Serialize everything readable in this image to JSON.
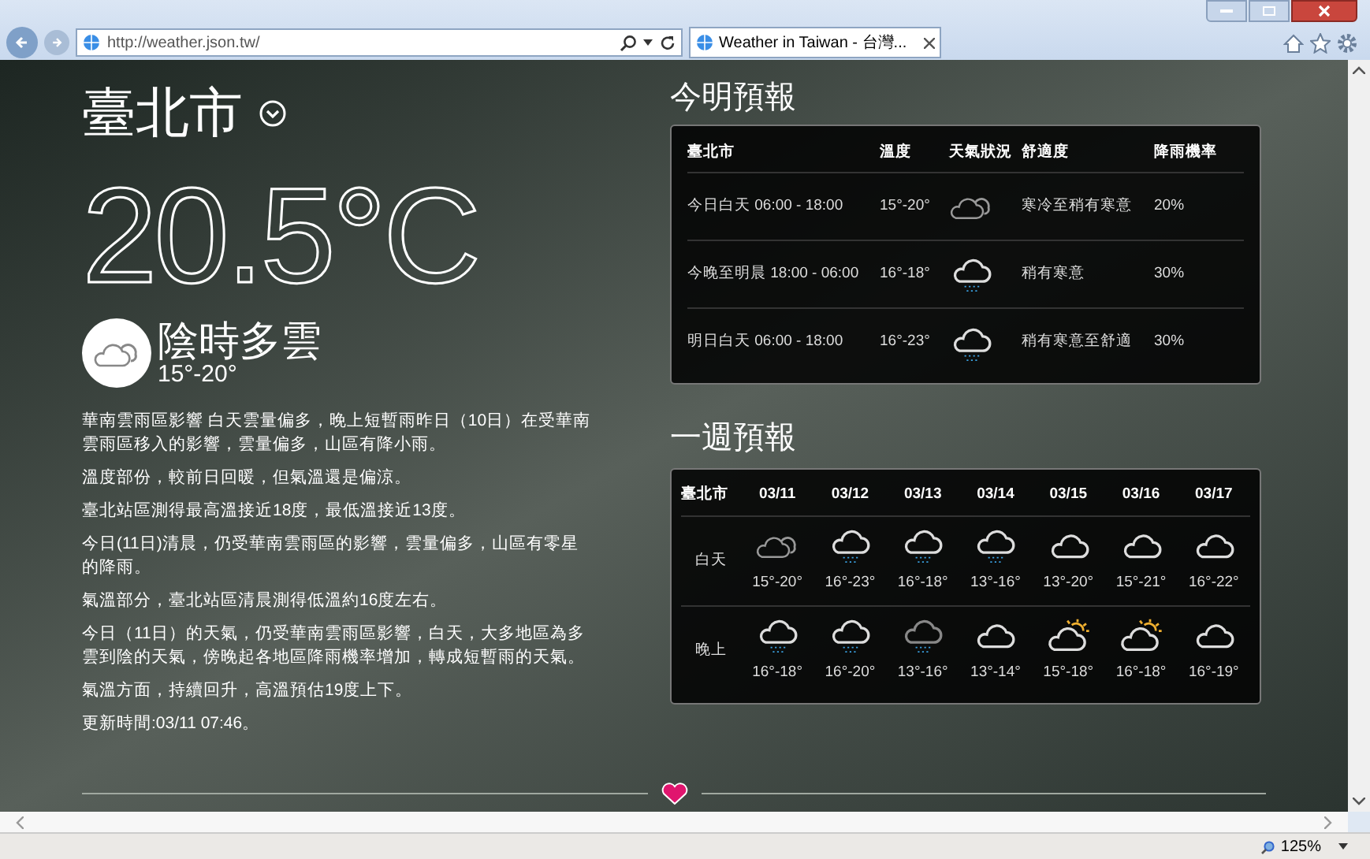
{
  "browser": {
    "address": "http://weather.json.tw/",
    "tab_title": "Weather in Taiwan - 台灣...",
    "zoom": "125%"
  },
  "current": {
    "city": "臺北市",
    "temperature": "20.5°C",
    "condition": "陰時多雲",
    "range": "15°-20°",
    "paragraphs": [
      "華南雲雨區影響 白天雲量偏多，晚上短暫雨昨日（10日）在受華南雲雨區移入的影響，雲量偏多，山區有降小雨。",
      "溫度部份，較前日回暖，但氣溫還是偏涼。",
      "臺北站區測得最高溫接近18度，最低溫接近13度。",
      "今日(11日)清晨，仍受華南雲雨區的影響，雲量偏多，山區有零星的降雨。",
      "氣溫部分，臺北站區清晨測得低溫約16度左右。",
      "今日（11日）的天氣，仍受華南雲雨區影響，白天，大多地區為多雲到陰的天氣，傍晚起各地區降雨機率增加，轉成短暫雨的天氣。",
      "氣溫方面，持續回升，高溫預估19度上下。",
      "更新時間:03/11 07:46。"
    ]
  },
  "short_forecast": {
    "title": "今明預報",
    "columns": [
      "臺北市",
      "溫度",
      "天氣狀況",
      "舒適度",
      "降雨機率"
    ],
    "rows": [
      {
        "period": "今日白天 06:00 - 18:00",
        "temp": "15°-20°",
        "kind": "cloudy",
        "comfort": "寒冷至稍有寒意",
        "rain": "20%"
      },
      {
        "period": "今晚至明晨 18:00 - 06:00",
        "temp": "16°-18°",
        "kind": "rain",
        "comfort": "稍有寒意",
        "rain": "30%"
      },
      {
        "period": "明日白天 06:00 - 18:00",
        "temp": "16°-23°",
        "kind": "rain",
        "comfort": "稍有寒意至舒適",
        "rain": "30%"
      }
    ]
  },
  "week_forecast": {
    "title": "一週預報",
    "corner": "臺北市",
    "dates": [
      "03/11",
      "03/12",
      "03/13",
      "03/14",
      "03/15",
      "03/16",
      "03/17"
    ],
    "rows": [
      {
        "label": "白天",
        "cells": [
          {
            "kind": "cloudy",
            "temp": "15°-20°"
          },
          {
            "kind": "rain",
            "temp": "16°-23°"
          },
          {
            "kind": "rain",
            "temp": "16°-18°"
          },
          {
            "kind": "rain",
            "temp": "13°-16°"
          },
          {
            "kind": "cloud",
            "temp": "13°-20°"
          },
          {
            "kind": "cloud",
            "temp": "15°-21°"
          },
          {
            "kind": "cloud",
            "temp": "16°-22°"
          }
        ]
      },
      {
        "label": "晚上",
        "cells": [
          {
            "kind": "rain",
            "temp": "16°-18°"
          },
          {
            "kind": "rain",
            "temp": "16°-20°"
          },
          {
            "kind": "rain-dim",
            "temp": "13°-16°"
          },
          {
            "kind": "cloud",
            "temp": "13°-14°"
          },
          {
            "kind": "sun-cloud",
            "temp": "15°-18°"
          },
          {
            "kind": "sun-cloud",
            "temp": "16°-18°"
          },
          {
            "kind": "cloud",
            "temp": "16°-19°"
          }
        ]
      }
    ]
  }
}
